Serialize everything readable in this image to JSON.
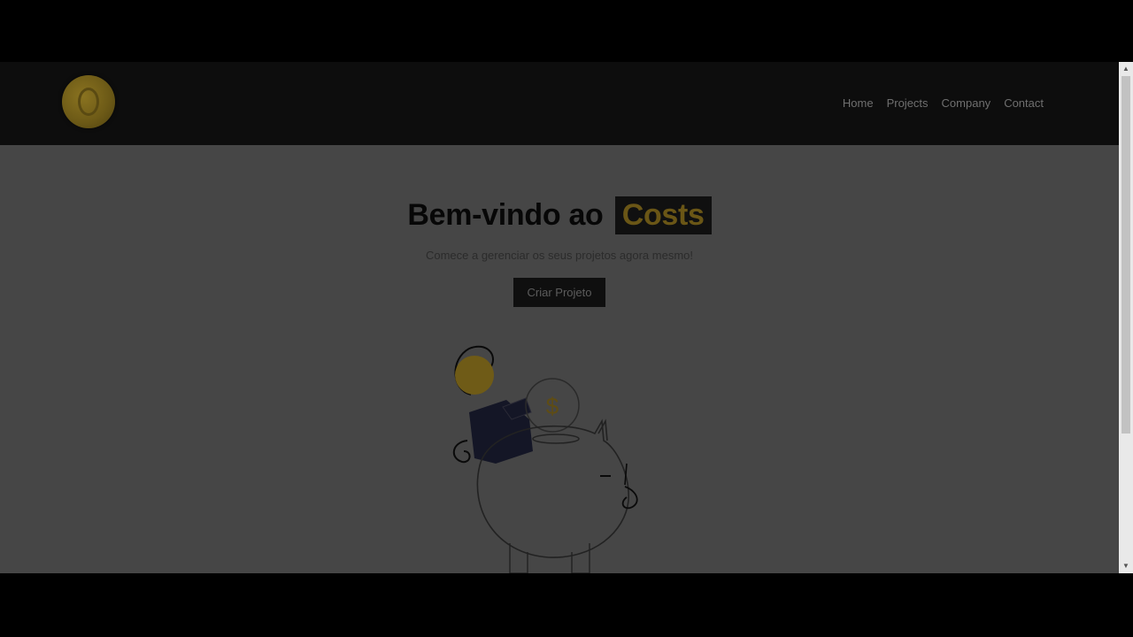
{
  "nav": {
    "links": [
      "Home",
      "Projects",
      "Company",
      "Contact"
    ]
  },
  "hero": {
    "title": "Bem-vindo ao",
    "brand": "Costs",
    "subtitle": "Comece a gerenciar os seus projetos agora mesmo!",
    "button_label": "Criar Projeto"
  },
  "illustration": {
    "coin_symbol": "$"
  },
  "colors": {
    "navbar": "#0d0d0d",
    "page_overlay": "#464646",
    "brand_accent": "#6a5616",
    "button_bg": "#0f0f0f"
  },
  "icons": {
    "logo": "gold-coin-icon",
    "scroll_up": "chevron-up-icon",
    "scroll_down": "chevron-down-icon"
  }
}
